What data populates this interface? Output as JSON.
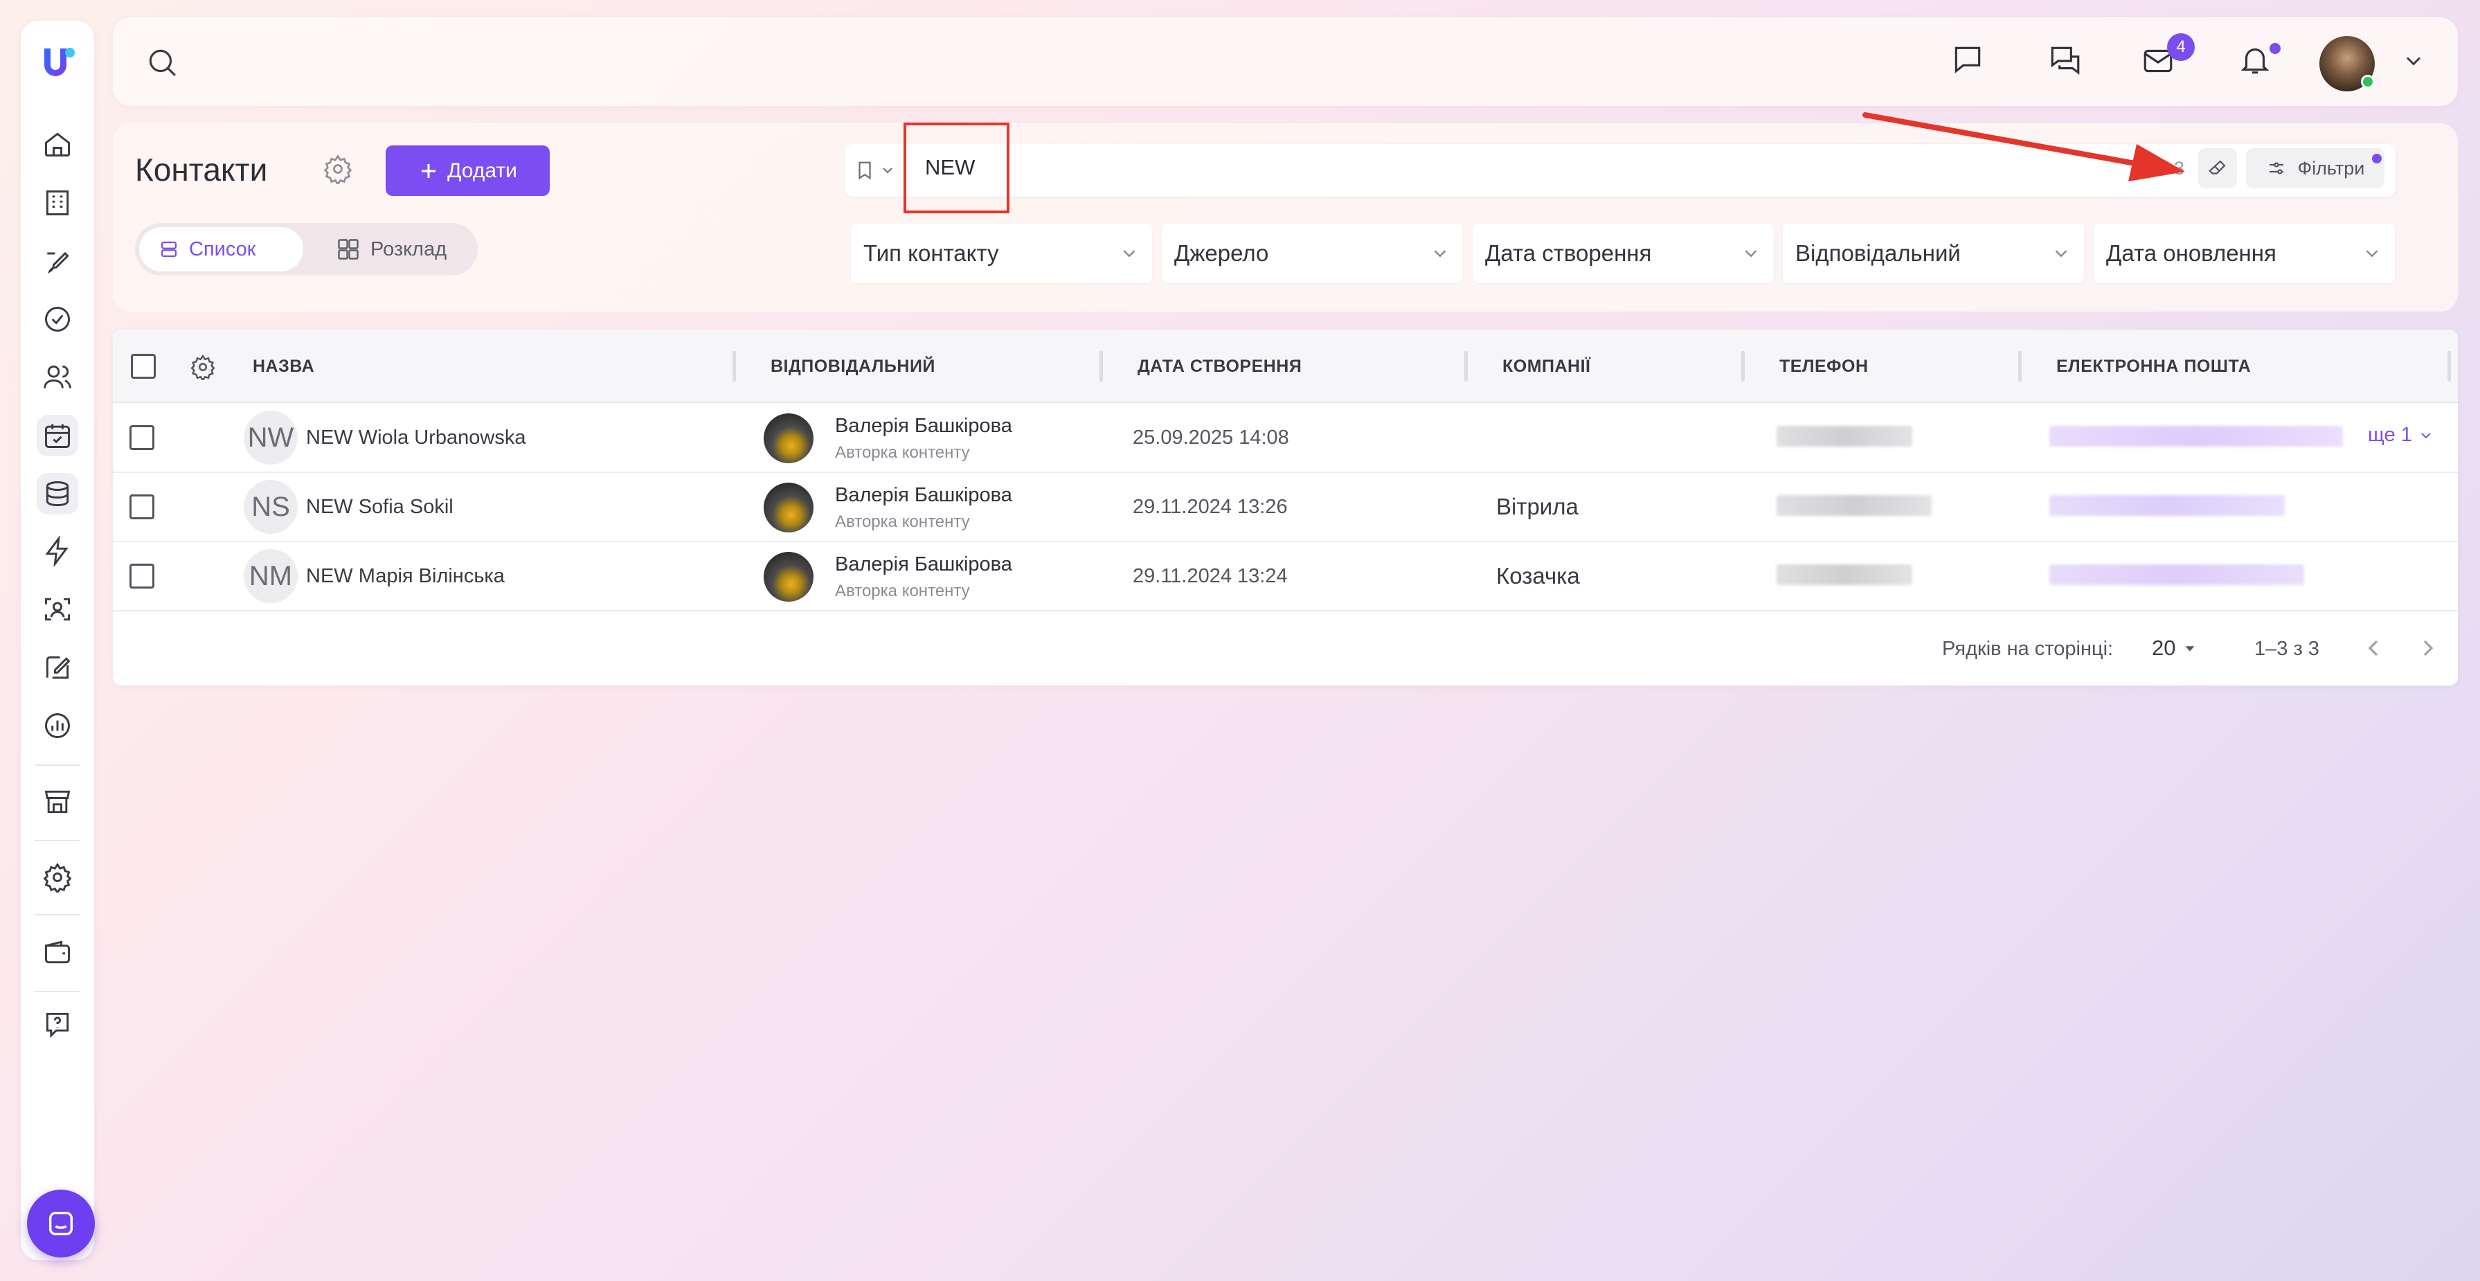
{
  "sidebar": {
    "items": [
      {
        "icon": "home-icon"
      },
      {
        "icon": "building-icon"
      },
      {
        "icon": "edit-doc-icon"
      },
      {
        "icon": "check-circle-icon"
      },
      {
        "icon": "users-icon"
      },
      {
        "icon": "calendar-check-icon",
        "active": true
      },
      {
        "icon": "database-icon",
        "active": true
      },
      {
        "icon": "lightning-icon"
      },
      {
        "icon": "scan-user-icon"
      },
      {
        "icon": "pencil-note-icon"
      },
      {
        "icon": "chart-circle-icon"
      },
      {
        "icon": "store-icon"
      },
      {
        "icon": "settings-icon"
      },
      {
        "icon": "wallet-icon"
      },
      {
        "icon": "help-icon"
      }
    ]
  },
  "topbar": {
    "mail_badge": "4"
  },
  "header": {
    "title": "Контакти",
    "add_label": "Додати",
    "views": {
      "list": "Список",
      "schedule": "Розклад"
    },
    "search_value": "NEW",
    "result_count": "3",
    "filters_label": "Фільтри",
    "filters": [
      "Тип контакту",
      "Джерело",
      "Дата створення",
      "Відповідальний",
      "Дата оновлення"
    ]
  },
  "table": {
    "columns": [
      "НАЗВА",
      "ВІДПОВІДАЛЬНИЙ",
      "ДАТА СТВОРЕННЯ",
      "КОМПАНІЇ",
      "ТЕЛЕФОН",
      "ЕЛЕКТРОННА ПОШТА"
    ],
    "rows": [
      {
        "initials": "NW",
        "name": "NEW Wiola Urbanowska",
        "responsible": "Валерія Башкірова",
        "role": "Авторка контенту",
        "created": "25.09.2025 14:08",
        "company": "",
        "more": "ще 1"
      },
      {
        "initials": "NS",
        "name": "NEW Sofia Sokil",
        "responsible": "Валерія Башкірова",
        "role": "Авторка контенту",
        "created": "29.11.2024 13:26",
        "company": "Вітрила"
      },
      {
        "initials": "NM",
        "name": "NEW Марія Вілінська",
        "responsible": "Валерія Башкірова",
        "role": "Авторка контенту",
        "created": "29.11.2024 13:24",
        "company": "Козачка"
      }
    ]
  },
  "pagination": {
    "rows_label": "Рядків на сторінці:",
    "rows_per_page": "20",
    "range": "1–3 з 3"
  },
  "colors": {
    "accent": "#7c4df1",
    "annotation": "#e5352b",
    "online": "#2fc15b"
  }
}
